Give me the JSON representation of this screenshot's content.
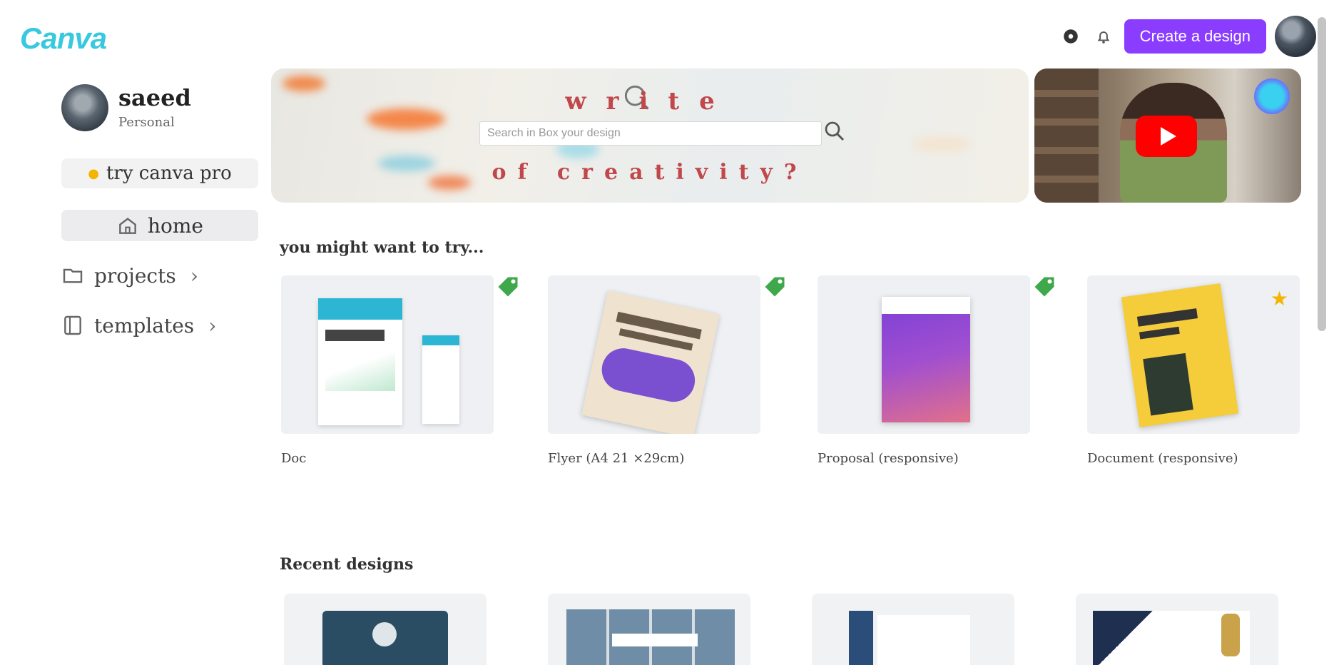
{
  "app": {
    "logo": "Canva"
  },
  "header": {
    "create_button": "Create a design"
  },
  "sidebar": {
    "user_name": "saeed",
    "user_plan": "Personal",
    "pro_button": "try canva pro",
    "nav": [
      {
        "label": "home"
      },
      {
        "label": "projects"
      },
      {
        "label": "templates"
      }
    ]
  },
  "banner": {
    "title": "write",
    "subtitle": "of creativity?",
    "search_placeholder": "Search in Box your design"
  },
  "suggestions": {
    "heading": "you might want to try...",
    "cards": [
      {
        "label": "Doc"
      },
      {
        "label": "Flyer (A4 21 ×29cm)"
      },
      {
        "label": "Proposal (responsive)"
      },
      {
        "label": "Document (responsive)"
      }
    ]
  },
  "recent": {
    "heading": "Recent designs"
  },
  "colors": {
    "accent": "#8b3dff",
    "logo_teal": "#38c8e0",
    "youtube_red": "#ff0000",
    "tag_green": "#3ea84a"
  }
}
